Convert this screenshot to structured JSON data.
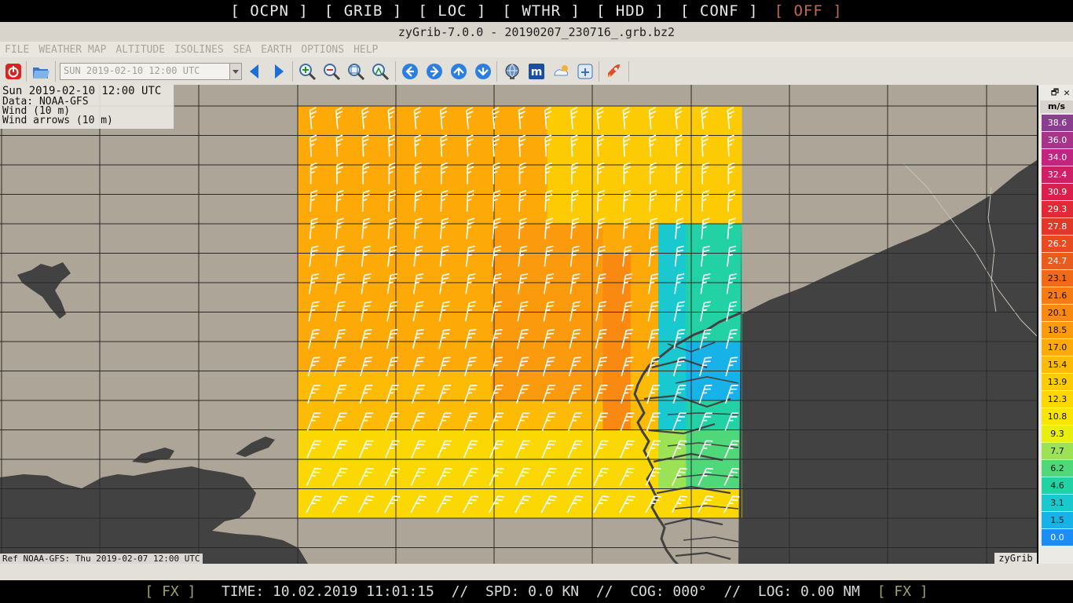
{
  "topbar": {
    "buttons": [
      "[ OCPN ]",
      "[ GRIB ]",
      "[ LOC ]",
      "[ WTHR ]",
      "[ HDD ]",
      "[ CONF ]",
      "[ OFF ]"
    ]
  },
  "window": {
    "title": "zyGrib-7.0.0 - 20190207_230716_.grb.bz2"
  },
  "menu": {
    "items": [
      "FILE",
      "WEATHER MAP",
      "ALTITUDE",
      "ISOLINES",
      "SEA",
      "EARTH",
      "OPTIONS",
      "HELP"
    ]
  },
  "toolbar": {
    "date_value": "SUN 2019-02-10 12:00 UTC",
    "icons": [
      "power-icon",
      "open-folder-icon",
      "prev-arrow-icon",
      "next-arrow-icon",
      "zoom-in-icon",
      "zoom-out-icon",
      "zoom-fit-icon",
      "zoom-all-icon",
      "pan-left-icon",
      "pan-right-icon",
      "pan-up-icon",
      "pan-down-icon",
      "globe-icon",
      "meteotable-icon",
      "weather-station-icon",
      "gpx-icon",
      "rocket-icon"
    ]
  },
  "overlay": {
    "line1": "Sun 2019-02-10 12:00 UTC",
    "line2": "Data: NOAA-GFS",
    "line3": "Wind (10 m)",
    "line4": "Wind arrows (10 m)",
    "ref": "Ref NOAA-GFS: Thu 2019-02-07 12:00 UTC",
    "brand": "zyGrib"
  },
  "legend": {
    "unit": "m/s",
    "entries": [
      {
        "value": "38.6",
        "color": "#8b3d8f",
        "text": "#ffffff"
      },
      {
        "value": "36.0",
        "color": "#a8348a",
        "text": "#ffffff"
      },
      {
        "value": "34.0",
        "color": "#c02680",
        "text": "#ffffff"
      },
      {
        "value": "32.4",
        "color": "#cf1f67",
        "text": "#ffffff"
      },
      {
        "value": "30.9",
        "color": "#d9204c",
        "text": "#ffffff"
      },
      {
        "value": "29.3",
        "color": "#e02a36",
        "text": "#ffffff"
      },
      {
        "value": "27.8",
        "color": "#e3372a",
        "text": "#ffffff"
      },
      {
        "value": "26.2",
        "color": "#e84a22",
        "text": "#ffffff"
      },
      {
        "value": "24.7",
        "color": "#ec5a1c",
        "text": "#ffffff"
      },
      {
        "value": "23.1",
        "color": "#f06a18",
        "text": "#111111"
      },
      {
        "value": "21.6",
        "color": "#f57b14",
        "text": "#111111"
      },
      {
        "value": "20.1",
        "color": "#f98910",
        "text": "#111111"
      },
      {
        "value": "18.5",
        "color": "#fb9a0c",
        "text": "#111111"
      },
      {
        "value": "17.0",
        "color": "#fdaa08",
        "text": "#111111"
      },
      {
        "value": "15.4",
        "color": "#fdbb05",
        "text": "#111111"
      },
      {
        "value": "13.9",
        "color": "#fccb04",
        "text": "#111111"
      },
      {
        "value": "12.3",
        "color": "#fbd803",
        "text": "#111111"
      },
      {
        "value": "10.8",
        "color": "#f9e403",
        "text": "#111111"
      },
      {
        "value": "9.3",
        "color": "#e8ee0e",
        "text": "#111111"
      },
      {
        "value": "7.7",
        "color": "#9be254",
        "text": "#111111"
      },
      {
        "value": "6.2",
        "color": "#4fd87a",
        "text": "#111111"
      },
      {
        "value": "4.6",
        "color": "#22d2a5",
        "text": "#111111"
      },
      {
        "value": "3.1",
        "color": "#19c9cf",
        "text": "#111111"
      },
      {
        "value": "1.5",
        "color": "#16b2e8",
        "text": "#111111"
      },
      {
        "value": "0.0",
        "color": "#1b8ef5",
        "text": "#ffffff"
      }
    ]
  },
  "status": {
    "fx_left": "[ FX ]",
    "time": "TIME: 10.02.2019 11:01:15",
    "sep1": "//",
    "spd": "SPD: 0.0 KN",
    "sep2": "//",
    "cog": "COG: 000°",
    "sep3": "//",
    "log": "LOG: 0.00 NM",
    "fx_right": "[ FX ]"
  }
}
